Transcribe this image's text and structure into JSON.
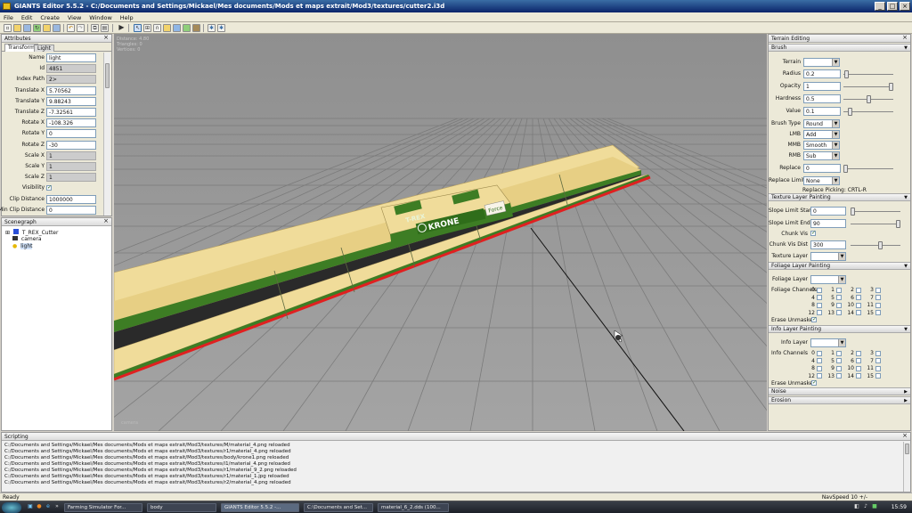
{
  "window": {
    "title": "GIANTS Editor 5.5.2 - C:/Documents and Settings/Mickael/Mes documents/Mods et maps extrait/Mod3/textures/cutter2.i3d"
  },
  "menu": [
    "File",
    "Edit",
    "Create",
    "View",
    "Window",
    "Help"
  ],
  "attributes": {
    "title": "Attributes",
    "tabs": [
      "Transform",
      "Light"
    ],
    "rows": [
      {
        "label": "Name",
        "value": "light",
        "ro": false
      },
      {
        "label": "Id",
        "value": "4851",
        "ro": true
      },
      {
        "label": "Index Path",
        "value": "2>",
        "ro": true
      },
      {
        "label": "Translate X",
        "value": "5.70562",
        "ro": false
      },
      {
        "label": "Translate Y",
        "value": "9.88243",
        "ro": false
      },
      {
        "label": "Translate Z",
        "value": "-7.32561",
        "ro": false
      },
      {
        "label": "Rotate X",
        "value": "-108.326",
        "ro": false
      },
      {
        "label": "Rotate Y",
        "value": "0",
        "ro": false
      },
      {
        "label": "Rotate Z",
        "value": "-30",
        "ro": false
      },
      {
        "label": "Scale X",
        "value": "1",
        "ro": true
      },
      {
        "label": "Scale Y",
        "value": "1",
        "ro": true
      },
      {
        "label": "Scale Z",
        "value": "1",
        "ro": true
      },
      {
        "label": "Visibility",
        "value": "",
        "ro": false
      },
      {
        "label": "Clip Distance",
        "value": "1000000",
        "ro": false
      },
      {
        "label": "Min Clip Distance",
        "value": "0",
        "ro": false
      }
    ]
  },
  "scenegraph": {
    "title": "Scenegraph",
    "items": [
      "T_REX_Cutter",
      "camera",
      "light"
    ]
  },
  "viewport": {
    "info": [
      "Distance: 4.80",
      "Triangles: 0",
      "Vertices: 0"
    ],
    "camera_label": "camera",
    "decal_brand": "KRONE",
    "decal_model": "T-REX",
    "decal_tag": "Force"
  },
  "terrain": {
    "title": "Terrain Editing",
    "brush": {
      "title": "Brush",
      "terrain_label": "Terrain",
      "terrain_value": "",
      "radius_label": "Radius",
      "radius": "0.2",
      "opacity_label": "Opacity",
      "opacity": "1",
      "hardness_label": "Hardness",
      "hardness": "0.5",
      "value_label": "Value",
      "value": "0.1",
      "brush_type_label": "Brush Type",
      "brush_type": "Round",
      "lmb_label": "LMB",
      "lmb": "Add",
      "mmb_label": "MMB",
      "mmb": "Smooth",
      "rmb_label": "RMB",
      "rmb": "Sub",
      "replace_label": "Replace",
      "replace": "0",
      "replace_limit_label": "Replace Limit",
      "replace_limit": "None",
      "replace_picking": "Replace Picking: CRTL-R",
      "slider_radius": 0.02,
      "slider_opacity": 1.0,
      "slider_hardness": 0.5,
      "slider_value": 0.1,
      "slider_replace": 0.0
    },
    "texture": {
      "title": "Texture Layer Painting",
      "slope_start_label": "Slope Limit Start",
      "slope_start": "0",
      "slope_end_label": "Slope Limit End",
      "slope_end": "90",
      "chunk_vis_label": "Chunk Vis",
      "chunk_dist_label": "Chunk Vis Dist",
      "chunk_dist": "300",
      "layer_label": "Texture Layer",
      "layer": "",
      "slider_slope_start": 0.0,
      "slider_slope_end": 1.0,
      "slider_chunk": 0.6
    },
    "foliage": {
      "title": "Foliage Layer Painting",
      "layer_label": "Foliage Layer",
      "layer": "",
      "channels_label": "Foliage Channels",
      "erase_label": "Erase Unmasked"
    },
    "info": {
      "title": "Info Layer Painting",
      "layer_label": "Info Layer",
      "layer": "",
      "channels_label": "Info Channels",
      "erase_label": "Erase Unmasked"
    },
    "channels": [
      "0",
      "1",
      "2",
      "3",
      "4",
      "5",
      "6",
      "7",
      "8",
      "9",
      "10",
      "11",
      "12",
      "13",
      "14",
      "15"
    ],
    "noise": "Noise",
    "erosion": "Erosion"
  },
  "scripting": {
    "title": "Scripting",
    "lines": [
      "C:/Documents and Settings/Mickael/Mes documents/Mods et maps extrait/Mod3/textures/M/material_4.png reloaded",
      "C:/Documents and Settings/Mickael/Mes documents/Mods et maps extrait/Mod3/textures/r1/material_4.png reloaded",
      "C:/Documents and Settings/Mickael/Mes documents/Mods et maps extrait/Mod3/textures/body/krone1.png reloaded",
      "C:/Documents and Settings/Mickael/Mes documents/Mods et maps extrait/Mod3/textures/i1/material_4.png reloaded",
      "C:/Documents and Settings/Mickael/Mes documents/Mods et maps extrait/Mod3/textures/r1/material_9_2.png reloaded",
      "C:/Documents and Settings/Mickael/Mes documents/Mods et maps extrait/Mod3/textures/r1/material_1.jpg reloaded",
      "C:/Documents and Settings/Mickael/Mes documents/Mods et maps extrait/Mod3/textures/r2/material_4.png reloaded"
    ]
  },
  "status": {
    "left": "Ready",
    "right": "NavSpeed 10 +/-"
  },
  "taskbar": {
    "items": [
      "Farming Simulator For...",
      "body",
      "GIANTS Editor 5.5.2 -...",
      "C:\\Documents and Set...",
      "material_6_2.dds (100..."
    ],
    "clock": "15:59"
  },
  "colors": {
    "accent_green": "#3a7a20",
    "body_yellow": "#f0dc9a",
    "red_stripe": "#e02020"
  }
}
